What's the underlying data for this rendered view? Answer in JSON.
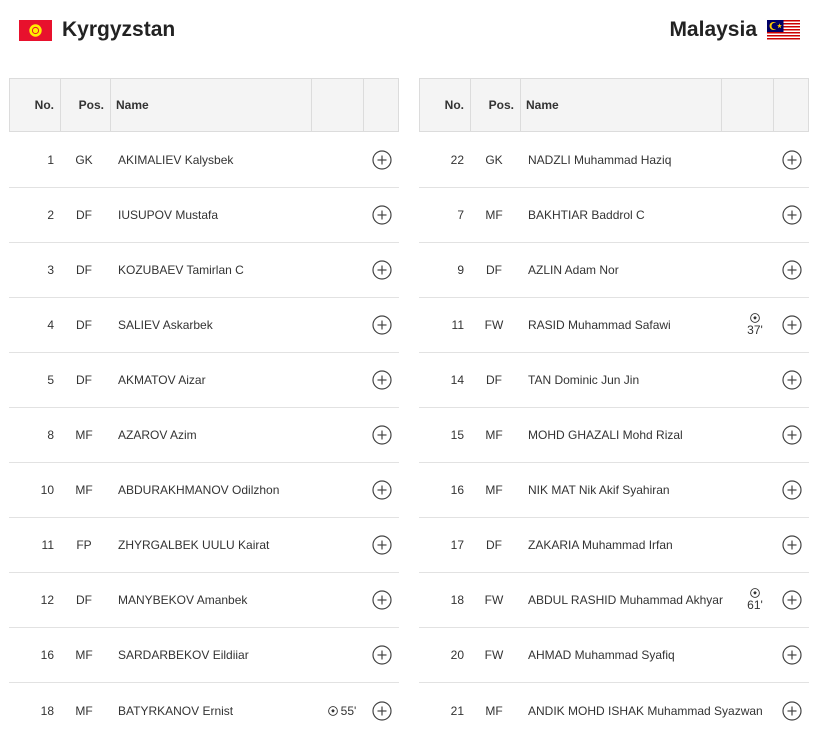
{
  "home": {
    "team_name": "Kyrgyzstan",
    "flag_icon": "kyrgyzstan-flag-icon",
    "flag_color": "#e8112d",
    "columns": {
      "no": "No.",
      "pos": "Pos.",
      "name": "Name"
    },
    "players": [
      {
        "no": "1",
        "pos": "GK",
        "name": "AKIMALIEV Kalysbek",
        "goal": ""
      },
      {
        "no": "2",
        "pos": "DF",
        "name": "IUSUPOV Mustafa",
        "goal": ""
      },
      {
        "no": "3",
        "pos": "DF",
        "name": "KOZUBAEV Tamirlan C",
        "goal": ""
      },
      {
        "no": "4",
        "pos": "DF",
        "name": "SALIEV Askarbek",
        "goal": ""
      },
      {
        "no": "5",
        "pos": "DF",
        "name": "AKMATOV Aizar",
        "goal": ""
      },
      {
        "no": "8",
        "pos": "MF",
        "name": "AZAROV Azim",
        "goal": ""
      },
      {
        "no": "10",
        "pos": "MF",
        "name": "ABDURAKHMANOV Odilzhon",
        "goal": ""
      },
      {
        "no": "11",
        "pos": "FP",
        "name": "ZHYRGALBEK UULU Kairat",
        "goal": ""
      },
      {
        "no": "12",
        "pos": "DF",
        "name": "MANYBEKOV Amanbek",
        "goal": ""
      },
      {
        "no": "16",
        "pos": "MF",
        "name": "SARDARBEKOV Eildiiar",
        "goal": ""
      },
      {
        "no": "18",
        "pos": "MF",
        "name": "BATYRKANOV Ernist",
        "goal": "55'"
      }
    ]
  },
  "away": {
    "team_name": "Malaysia",
    "flag_icon": "malaysia-flag-icon",
    "flag_color": "#cc0001",
    "columns": {
      "no": "No.",
      "pos": "Pos.",
      "name": "Name"
    },
    "players": [
      {
        "no": "22",
        "pos": "GK",
        "name": "NADZLI Muhammad Haziq",
        "goal": ""
      },
      {
        "no": "7",
        "pos": "MF",
        "name": "BAKHTIAR Baddrol C",
        "goal": ""
      },
      {
        "no": "9",
        "pos": "DF",
        "name": "AZLIN Adam Nor",
        "goal": ""
      },
      {
        "no": "11",
        "pos": "FW",
        "name": "RASID Muhammad Safawi",
        "goal": "37'"
      },
      {
        "no": "14",
        "pos": "DF",
        "name": "TAN Dominic Jun Jin",
        "goal": ""
      },
      {
        "no": "15",
        "pos": "MF",
        "name": "MOHD GHAZALI Mohd Rizal",
        "goal": ""
      },
      {
        "no": "16",
        "pos": "MF",
        "name": "NIK MAT Nik Akif Syahiran",
        "goal": ""
      },
      {
        "no": "17",
        "pos": "DF",
        "name": "ZAKARIA Muhammad Irfan",
        "goal": ""
      },
      {
        "no": "18",
        "pos": "FW",
        "name": "ABDUL RASHID Muhammad Akhyar",
        "goal": "61'"
      },
      {
        "no": "20",
        "pos": "FW",
        "name": "AHMAD Muhammad Syafiq",
        "goal": ""
      },
      {
        "no": "21",
        "pos": "MF",
        "name": "ANDIK MOHD ISHAK Muhammad Syazwan",
        "goal": ""
      }
    ]
  },
  "icons": {
    "goal": "football-icon",
    "expand": "plus-circle-icon"
  },
  "colors": {
    "header_bg": "#f4f4f4",
    "border": "#dcdcdc",
    "text": "#333333"
  }
}
